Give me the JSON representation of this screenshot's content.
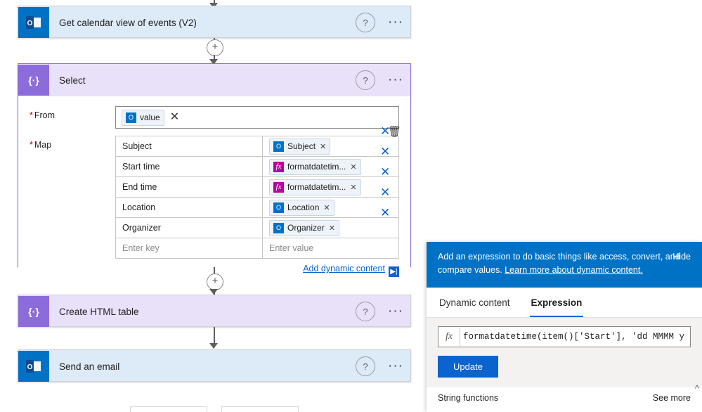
{
  "flow": {
    "steps": [
      {
        "id": "get-calendar-view",
        "title": "Get calendar view of events (V2)",
        "icon": "outlook-icon",
        "help": "?",
        "more": "···"
      },
      {
        "id": "select",
        "title": "Select",
        "icon": "select-braces-icon",
        "help": "?",
        "more": "···"
      },
      {
        "id": "create-html-table",
        "title": "Create HTML table",
        "icon": "select-braces-icon",
        "help": "?",
        "more": "···"
      },
      {
        "id": "send-an-email",
        "title": "Send an email",
        "icon": "outlook-icon",
        "help": "?",
        "more": "···"
      }
    ],
    "add_step_label": "+"
  },
  "select_action": {
    "from": {
      "label": "From",
      "required": "*",
      "token": {
        "text": "value",
        "icon": "outlook-icon"
      },
      "clear": "✕"
    },
    "map": {
      "label": "Map",
      "required": "*",
      "rows": [
        {
          "key": "Subject",
          "value": {
            "text": "Subject",
            "icon": "outlook-icon",
            "remove": "✕"
          },
          "delete": "✕",
          "extra": "trash-icon"
        },
        {
          "key": "Start time",
          "value": {
            "text": "formatdatetim...",
            "icon": "fx-icon",
            "remove": "✕"
          },
          "delete": "✕",
          "extra": ""
        },
        {
          "key": "End time",
          "value": {
            "text": "formatdatetim...",
            "icon": "fx-icon",
            "remove": "✕"
          },
          "delete": "✕",
          "extra": ""
        },
        {
          "key": "Location",
          "value": {
            "text": "Location",
            "icon": "outlook-icon",
            "remove": "✕"
          },
          "delete": "✕",
          "extra": ""
        },
        {
          "key": "Organizer",
          "value": {
            "text": "Organizer",
            "icon": "outlook-icon",
            "remove": "✕"
          },
          "delete": "✕",
          "extra": ""
        }
      ],
      "new_row": {
        "key_placeholder": "Enter key",
        "value_placeholder": "Enter value"
      }
    },
    "add_dynamic_content": "Add dynamic content"
  },
  "expression_panel": {
    "info_text_1": "Add an expression to do basic things like access, convert, and compare values. ",
    "info_link": "Learn more about dynamic content.",
    "hide_label": "Hide",
    "tabs": [
      {
        "label": "Dynamic content",
        "active": false
      },
      {
        "label": "Expression",
        "active": true
      }
    ],
    "fx_badge": "fx",
    "expression_value": "formatdatetime(item()['Start'], 'dd MMMM y",
    "update_label": "Update",
    "footer_title": "String functions",
    "see_more": "See more"
  },
  "colors": {
    "outlook_blue": "#0072c6",
    "select_purple": "#8c6cdb",
    "select_header": "#e9e1fa",
    "step_header_blue": "#ddeaf7",
    "accent_link": "#0b63ce",
    "panel_header": "#0072c6"
  }
}
